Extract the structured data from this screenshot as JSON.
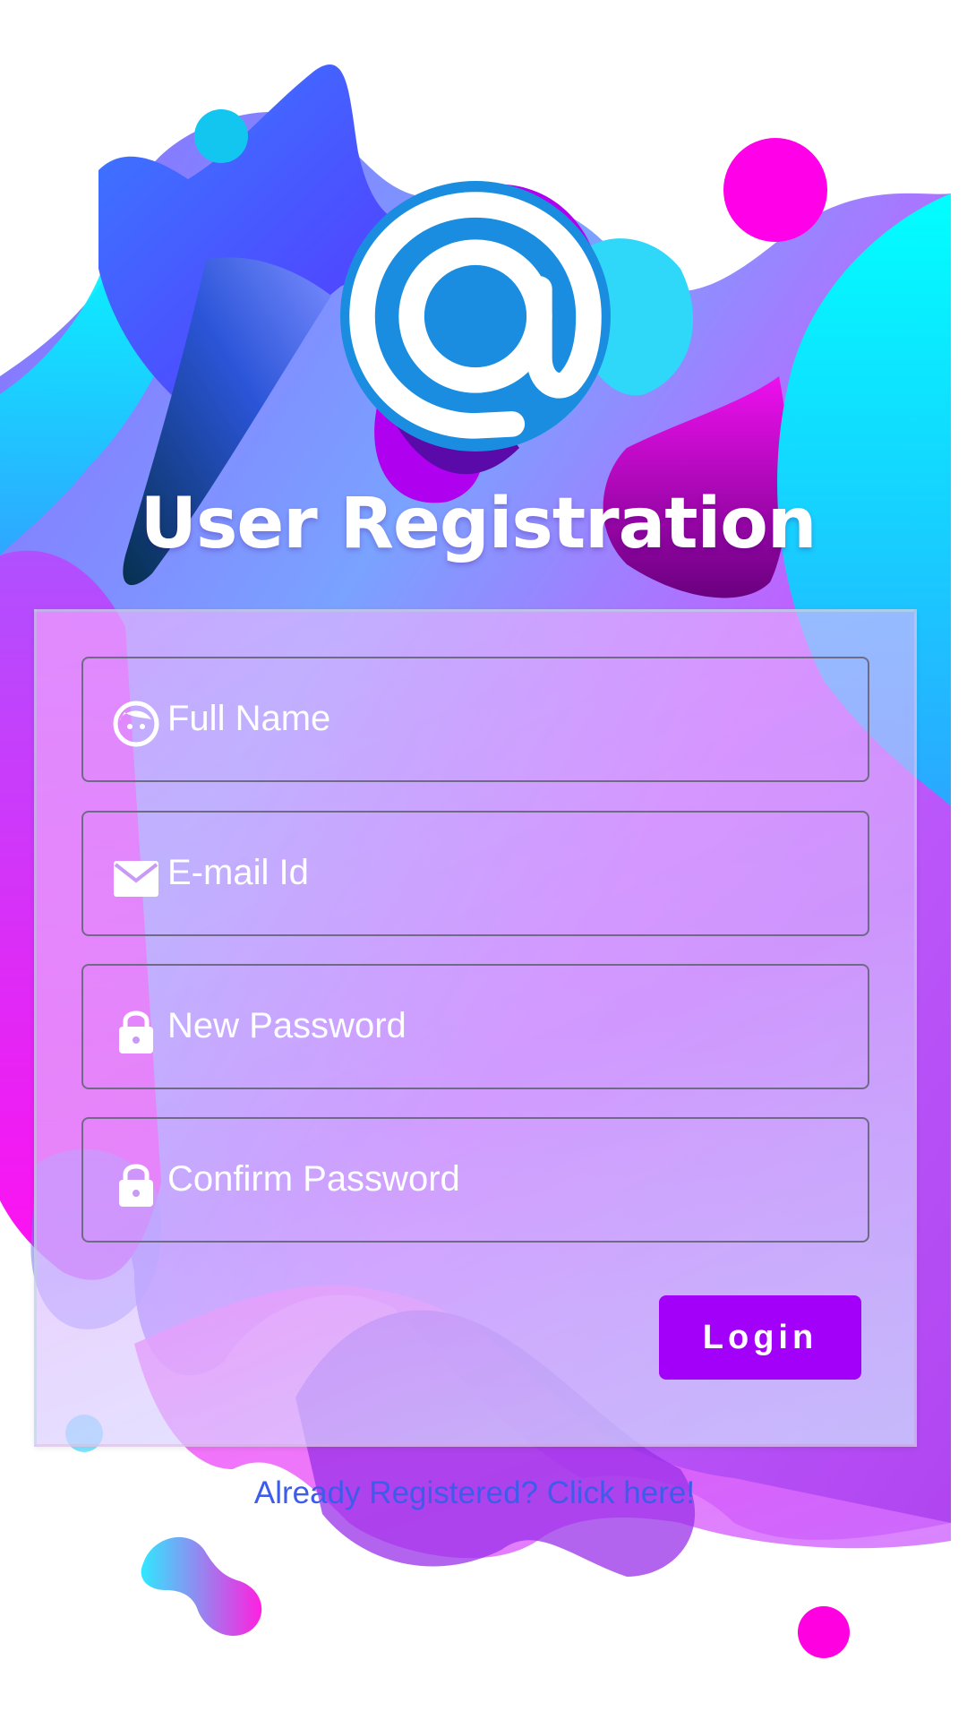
{
  "title": "User Registration",
  "fields": [
    {
      "placeholder": "Full Name",
      "icon": "face-icon",
      "value": ""
    },
    {
      "placeholder": "E-mail Id",
      "icon": "envelope-icon",
      "value": ""
    },
    {
      "placeholder": "New Password",
      "icon": "lock-icon",
      "value": ""
    },
    {
      "placeholder": "Confirm Password",
      "icon": "lock-icon",
      "value": ""
    }
  ],
  "login_button": "Login",
  "register_link": "Already Registered? Click here!",
  "colors": {
    "accent": "#a200f8",
    "logo": "#1a8de0",
    "link": "#3d5cea",
    "magenta": "#ff00f0",
    "cyan": "#00f0ff"
  }
}
